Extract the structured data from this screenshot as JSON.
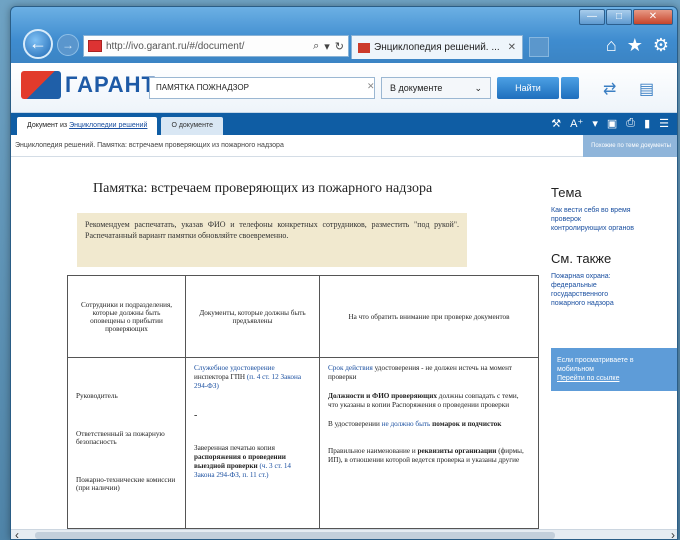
{
  "browser": {
    "address_url": "http://ivo.garant.ru/#/document/",
    "tab_title": "Энциклопедия решений. ...",
    "window_controls": [
      "—",
      "□",
      "✕"
    ],
    "toolbar_icons": [
      "home-icon",
      "star-icon",
      "gear-icon"
    ]
  },
  "app": {
    "logo_text": "ГАРАНТ",
    "search_value": "ПАМЯТКА ПОЖНАДЗОР",
    "scope_label": "В документе",
    "find_label": "Найти",
    "header_icons": [
      "compare-icon",
      "docs-icon"
    ]
  },
  "doc_tabs": {
    "tab1_prefix": "Документ из ",
    "tab1_link": "Энциклопедии решений",
    "tab2": "О документе",
    "tools": [
      "tools-icon",
      "A⁺",
      "▾",
      "save-icon",
      "print-icon",
      "bookmark-icon",
      "menu-icon"
    ]
  },
  "breadcrumb": "Энциклопедия решений. Памятка: встречаем проверяющих из пожарного надзора",
  "related_tag": "Похожие по теме документы",
  "document": {
    "title": "Памятка: встречаем проверяющих из пожарного надзора",
    "note": "Рекомендуем распечатать, указав ФИО и телефоны конкретных сотрудников, разместить \"под рукой\". Распечатанный вариант памятки обновляйте своевременно.",
    "table": {
      "headers": [
        "Сотрудники и подразделения, которые должны быть оповещены о прибытии проверяющих",
        "Документы, которые должны быть предъявлены",
        "На что обратить внимание при проверке документов"
      ],
      "col1": [
        "Руководитель",
        "Ответственный за пожарную безопасность",
        "Пожарно-технические комиссии (при наличии)"
      ],
      "col2": {
        "p1_link": "Служебное удостоверение",
        "p1_text": " инспектора ГПН ",
        "p1_ref": "(п. 4 ст. 12 Закона 294-ФЗ)",
        "dash": "-",
        "p3_text": "Заверенная печатью копия ",
        "p3_bold": "распоряжения о проведении выездной проверки",
        "p3_ref": " (ч. 3 ст. 14 Закона 294-ФЗ, п. 11 ст.)"
      },
      "col3": {
        "p1_link": "Срок действия",
        "p1_text": " удостоверения - не должен истечь на момент проверки",
        "p2_bold": "Должности и ФИО проверяющих",
        "p2_text": " должны совпадать с теми, что указаны в копии Распоряжения о проведении проверки",
        "p3_text": "В удостоверении ",
        "p3_link": "не должно быть",
        "p3_bold": " помарок и подчисток",
        "p4_text": "Правильное наименование и ",
        "p4_bold": "реквизиты организации",
        "p4_tail": " (фирмы, ИП), в отношении которой ведется проверка и указаны другие"
      }
    }
  },
  "sidebar": {
    "theme_heading": "Тема",
    "theme_links": [
      "Как вести себя во время",
      "проверок",
      "контролирующих органов"
    ],
    "see_also_heading": "См. также",
    "see_also_links": [
      "Пожарная охрана:",
      "федеральные",
      "государственного",
      "пожарного надзора"
    ],
    "box_line1": "Если просматриваете в",
    "box_line2": "мобильном",
    "box_link": "Перейти по ссылке"
  }
}
